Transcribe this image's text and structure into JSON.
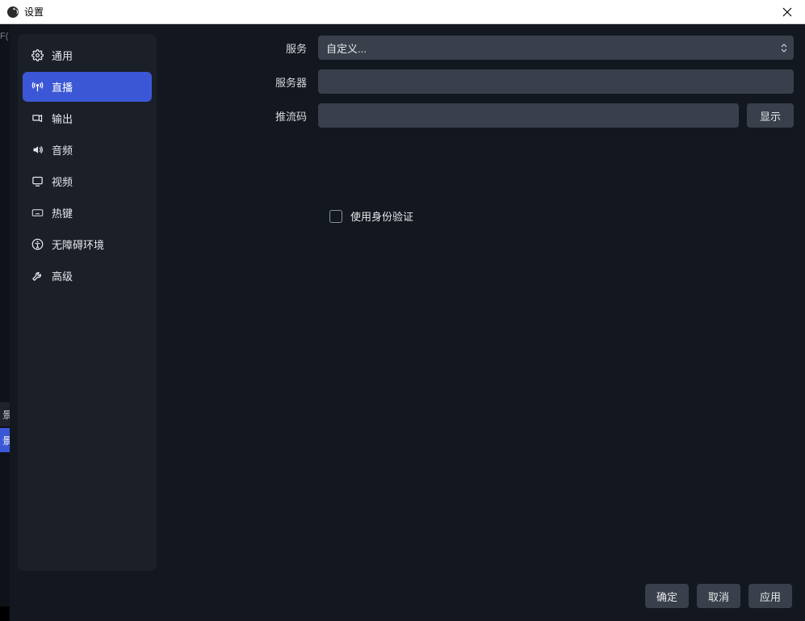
{
  "window": {
    "title": "设置"
  },
  "sidebar": {
    "items": [
      {
        "label": "通用",
        "icon": "gear-icon"
      },
      {
        "label": "直播",
        "icon": "antenna-icon"
      },
      {
        "label": "输出",
        "icon": "output-icon"
      },
      {
        "label": "音频",
        "icon": "speaker-icon"
      },
      {
        "label": "视频",
        "icon": "monitor-icon"
      },
      {
        "label": "热键",
        "icon": "keyboard-icon"
      },
      {
        "label": "无障碍环境",
        "icon": "accessibility-icon"
      },
      {
        "label": "高级",
        "icon": "tools-icon"
      }
    ],
    "active_index": 1
  },
  "form": {
    "service_label": "服务",
    "service_value": "自定义...",
    "server_label": "服务器",
    "server_value": "",
    "streamkey_label": "推流码",
    "streamkey_value": "",
    "show_button": "显示",
    "auth_checkbox_label": "使用身份验证",
    "auth_checked": false
  },
  "footer": {
    "ok": "确定",
    "cancel": "取消",
    "apply": "应用"
  },
  "background": {
    "left_hint": "F(",
    "tab1": "景",
    "tab2": "景"
  }
}
